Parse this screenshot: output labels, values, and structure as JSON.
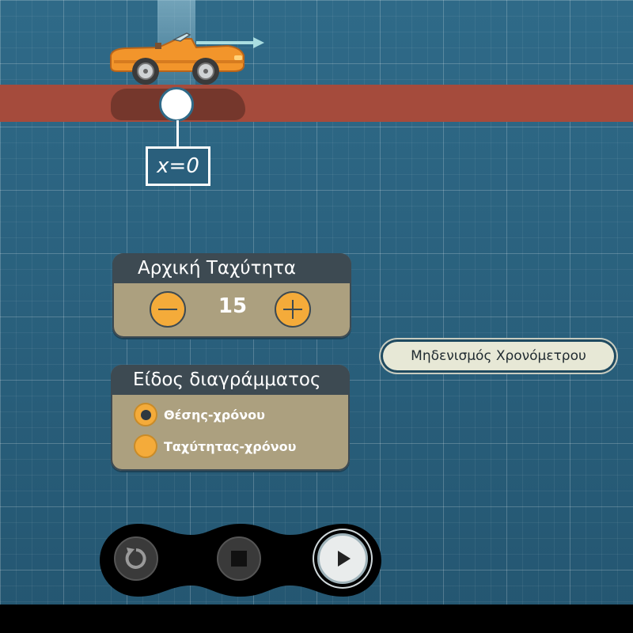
{
  "track": {
    "position_label": "x=0"
  },
  "speed_panel": {
    "title": "Αρχική Ταχύτητα",
    "value": "15",
    "minus_icon": "minus-icon",
    "plus_icon": "plus-icon"
  },
  "chart_type_panel": {
    "title": "Είδος διαγράμματος",
    "options": [
      {
        "label": "Θέσης-χρόνου",
        "selected": true
      },
      {
        "label": "Ταχύτητας-χρόνου",
        "selected": false
      }
    ]
  },
  "reset_timer_label": "Μηδενισμός Χρονόμετρου",
  "playback": {
    "restart_icon": "restart-icon",
    "stop_icon": "stop-icon",
    "play_icon": "play-icon"
  },
  "colors": {
    "background": "#2a5f7c",
    "road": "#a54b3c",
    "accent": "#f4ab3a",
    "panel_head": "#3d4a52",
    "panel_body": "#aca07f"
  }
}
